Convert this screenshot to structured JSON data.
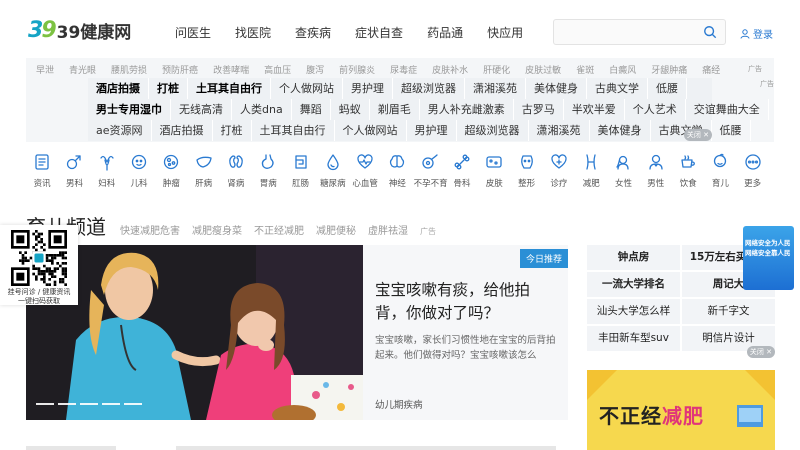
{
  "header": {
    "logo_mark_a": "3",
    "logo_mark_b": "9",
    "logo_text": "39健康网",
    "nav": [
      "问医生",
      "找医院",
      "查疾病",
      "症状自查",
      "药品通",
      "快应用"
    ],
    "search_placeholder": "",
    "login": "登录"
  },
  "tag_cloud": {
    "row1": [
      "早泄",
      "青光眼",
      "腰肌劳损",
      "预防肝癌",
      "改善哮喘",
      "高血压",
      "腹泻",
      "前列腺炎",
      "尿毒症",
      "皮肤补水",
      "肝硬化",
      "皮肤过敏",
      "雀斑",
      "白癜风",
      "牙龈肿痛",
      "痛经"
    ],
    "ad_label": "广告"
  },
  "overlay_ads": {
    "rows": [
      [
        "酒店拍摄",
        "打桩",
        "土耳其自由行",
        "个人做网站",
        "男护理",
        "超级浏览器",
        "潇湘溪苑",
        "美体健身",
        "古典文学",
        "低腰"
      ],
      [
        "男士专用湿巾",
        "无线高清",
        "人类dna",
        "舞蹈",
        "蚂蚁",
        "剃眉毛",
        "男人补充雌激素",
        "古罗马",
        "半欢半爱",
        "个人艺术",
        "交谊舞曲大全"
      ],
      [
        "ae资源网",
        "酒店拍摄",
        "打桩",
        "土耳其自由行",
        "个人做网站",
        "男护理",
        "超级浏览器",
        "潇湘溪苑",
        "美体健身",
        "古典文学",
        "低腰"
      ]
    ],
    "bold": [
      "酒店拍摄",
      "打桩",
      "土耳其自由行",
      "男士专用湿巾"
    ],
    "close_label": "关闭 ✕",
    "ad_label": "广告"
  },
  "icons": [
    {
      "label": "资讯",
      "icon": "news-icon"
    },
    {
      "label": "男科",
      "icon": "male-icon"
    },
    {
      "label": "妇科",
      "icon": "uterus-icon"
    },
    {
      "label": "儿科",
      "icon": "baby-icon"
    },
    {
      "label": "肿瘤",
      "icon": "tumor-icon"
    },
    {
      "label": "肝病",
      "icon": "liver-icon"
    },
    {
      "label": "肾病",
      "icon": "kidney-icon"
    },
    {
      "label": "胃病",
      "icon": "stomach-icon"
    },
    {
      "label": "肛肠",
      "icon": "intestine-icon"
    },
    {
      "label": "糖尿病",
      "icon": "drop-icon"
    },
    {
      "label": "心血管",
      "icon": "heart-icon"
    },
    {
      "label": "神经",
      "icon": "brain-icon"
    },
    {
      "label": "不孕不育",
      "icon": "fertility-icon"
    },
    {
      "label": "骨科",
      "icon": "bone-icon"
    },
    {
      "label": "皮肤",
      "icon": "skin-icon"
    },
    {
      "label": "整形",
      "icon": "face-icon"
    },
    {
      "label": "诊疗",
      "icon": "heart-plus-icon"
    },
    {
      "label": "减肥",
      "icon": "body-icon"
    },
    {
      "label": "女性",
      "icon": "female-icon"
    },
    {
      "label": "男性",
      "icon": "man-icon"
    },
    {
      "label": "饮食",
      "icon": "cup-icon"
    },
    {
      "label": "育儿",
      "icon": "infant-icon"
    },
    {
      "label": "更多",
      "icon": "more-icon"
    }
  ],
  "section": {
    "title": "育儿频道",
    "links": [
      "快速减肥危害",
      "减肥瘦身菜",
      "不正经减肥",
      "减肥便秘",
      "虚胖祛湿"
    ],
    "ad_label": "广告"
  },
  "qr": {
    "line1": "挂号问诊 / 健康资讯",
    "line2": "一键扫码获取"
  },
  "hero": {
    "badge": "今日推荐",
    "title": "宝宝咳嗽有痰，给他拍背，你做对了吗？",
    "desc": "宝宝咳嗽，家长们习惯性地在宝宝的后背拍起来。他们做得对吗？宝宝咳嗽该怎么",
    "category": "幼儿期疾病"
  },
  "right_grid": {
    "rows": [
      [
        "钟点房",
        "15万左右买什么"
      ],
      [
        "一流大学排名",
        "周记大"
      ],
      [
        "汕头大学怎么样",
        "新千字文"
      ],
      [
        "丰田新车型suv",
        "明信片设计"
      ]
    ],
    "close_label": "关闭 ✕"
  },
  "float_ad": {
    "line1": "网络安全为人民",
    "line2": "网络安全靠人民"
  },
  "bottom_ad": {
    "text_a": "不正经",
    "text_b": "减肥"
  },
  "colors": {
    "brand": "#15a4c5",
    "accent": "#2a8fd6",
    "icon": "#2a7ad1"
  }
}
